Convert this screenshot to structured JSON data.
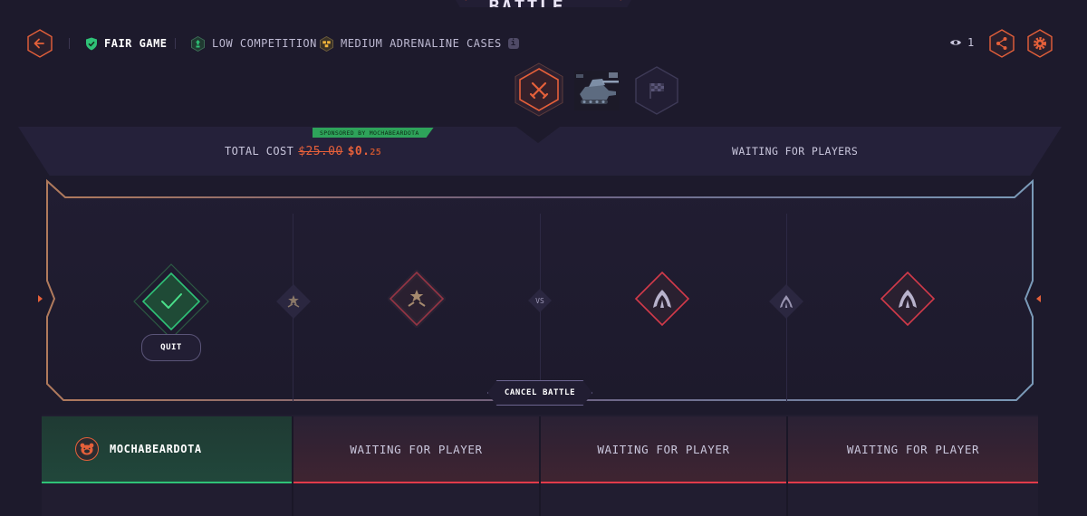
{
  "title": "CASE BATTLE",
  "header": {
    "tags": [
      {
        "label": "FAIR GAME",
        "icon": "shield-check-icon"
      },
      {
        "label": "LOW COMPETITION",
        "icon": "competition-icon"
      },
      {
        "label": "MEDIUM ADRENALINE CASES",
        "icon": "cases-icon"
      }
    ],
    "viewers": "1"
  },
  "info_bar": {
    "total_cost_label": "TOTAL COST",
    "old_price": "$25.00",
    "new_price": "$0.",
    "new_price_cents": "25",
    "sponsor": "SPONSORED BY MOCHABEARDOTA",
    "status": "WAITING FOR PLAYERS"
  },
  "arena": {
    "vs": "VS",
    "quit_label": "QUIT",
    "cancel_label": "CANCEL BATTLE"
  },
  "players": [
    {
      "name": "MOCHABEARDOTA",
      "state": "joined"
    },
    {
      "name": "WAITING FOR PLAYER",
      "state": "waiting"
    },
    {
      "name": "WAITING FOR PLAYER",
      "state": "waiting"
    },
    {
      "name": "WAITING FOR PLAYER",
      "state": "waiting"
    }
  ],
  "colors": {
    "accent": "#e5603a",
    "background": "#1d1a2c",
    "green": "#2fc277",
    "red": "#e23b4a",
    "sponsor_green": "#2ea35a"
  }
}
